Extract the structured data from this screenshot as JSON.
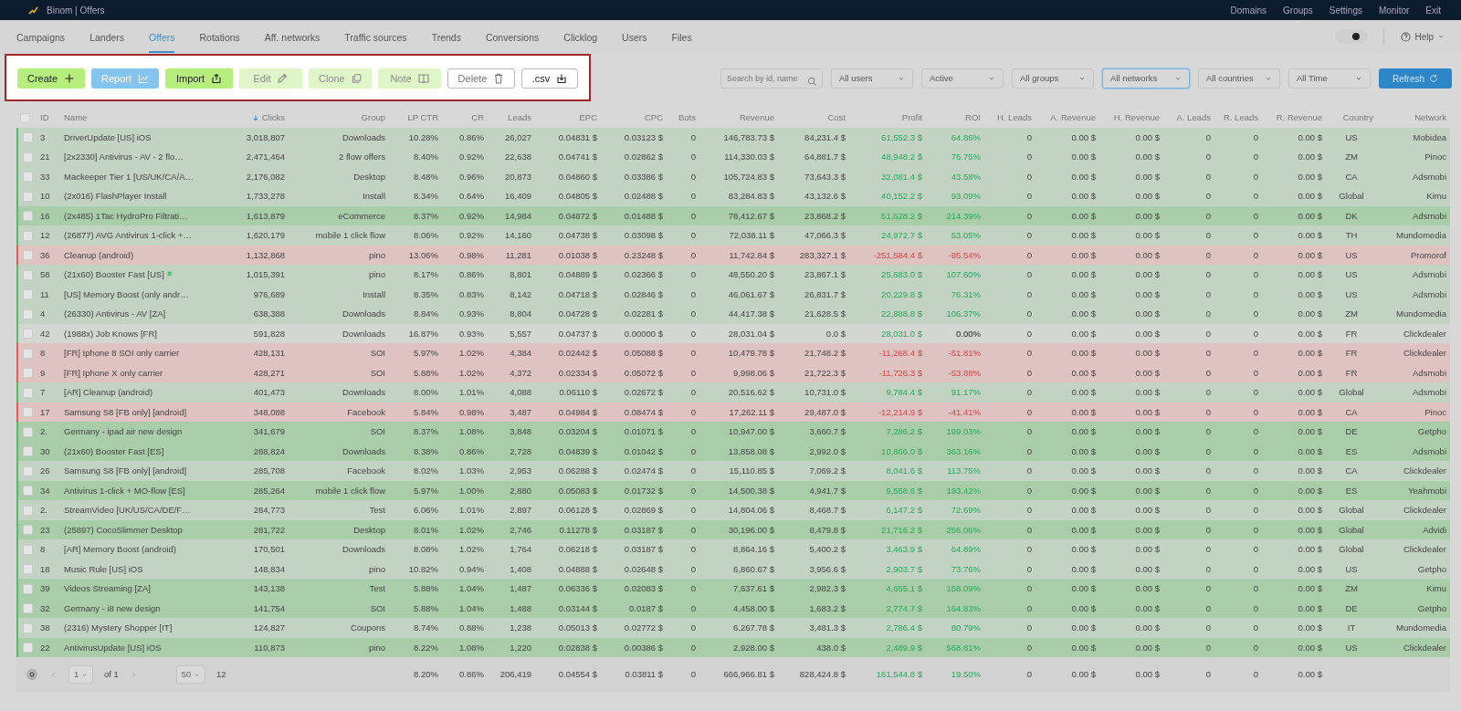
{
  "app_bar": {
    "title": "Binom | Offers",
    "links": [
      "Domains",
      "Groups",
      "Settings",
      "Monitor",
      "Exit"
    ]
  },
  "tabs": [
    {
      "label": "Campaigns",
      "selected": false
    },
    {
      "label": "Landers",
      "selected": false
    },
    {
      "label": "Offers",
      "selected": true
    },
    {
      "label": "Rotations",
      "selected": false
    },
    {
      "label": "Aff. networks",
      "selected": false
    },
    {
      "label": "Traffic sources",
      "selected": false
    },
    {
      "label": "Trends",
      "selected": false
    },
    {
      "label": "Conversions",
      "selected": false
    },
    {
      "label": "Clicklog",
      "selected": false
    },
    {
      "label": "Users",
      "selected": false
    },
    {
      "label": "Files",
      "selected": false
    }
  ],
  "theme_toggle": {
    "on": true
  },
  "help": {
    "label": "Help"
  },
  "toolbar": [
    {
      "label": "Create",
      "kind": "create"
    },
    {
      "label": "Report",
      "kind": "report"
    },
    {
      "label": "Import",
      "kind": "import"
    },
    {
      "label": "Edit",
      "kind": "edit"
    },
    {
      "label": "Clone",
      "kind": "clone"
    },
    {
      "label": "Note",
      "kind": "note"
    },
    {
      "label": "Delete",
      "kind": "delete"
    },
    {
      "label": ".csv",
      "kind": "export"
    }
  ],
  "search": {
    "placeholder": "Search by id, name"
  },
  "filters": [
    {
      "value": "All users",
      "focused": false
    },
    {
      "value": "Active",
      "focused": false
    },
    {
      "value": "All groups",
      "focused": false
    },
    {
      "value": "All networks",
      "focused": true
    },
    {
      "value": "All countries",
      "focused": false
    },
    {
      "value": "All Time",
      "focused": false
    }
  ],
  "refresh": {
    "label": "Refresh"
  },
  "table": {
    "select_all": {
      "checked": false
    },
    "columns": [
      {
        "label": "ID",
        "sorted": false
      },
      {
        "label": "Name",
        "sorted": false
      },
      {
        "label": "Clicks",
        "sorted": true
      },
      {
        "label": "Group",
        "sorted": false
      },
      {
        "label": "LP CTR",
        "sorted": false
      },
      {
        "label": "CR",
        "sorted": false
      },
      {
        "label": "Leads",
        "sorted": false
      },
      {
        "label": "EPC",
        "sorted": false
      },
      {
        "label": "CPC",
        "sorted": false
      },
      {
        "label": "Bots",
        "sorted": false
      },
      {
        "label": "Revenue",
        "sorted": false
      },
      {
        "label": "Cost",
        "sorted": false
      },
      {
        "label": "Profit",
        "sorted": false
      },
      {
        "label": "ROI",
        "sorted": false
      },
      {
        "label": "H. Leads",
        "sorted": false
      },
      {
        "label": "A. Revenue",
        "sorted": false
      },
      {
        "label": "H. Revenue",
        "sorted": false
      },
      {
        "label": "A. Leads",
        "sorted": false
      },
      {
        "label": "R. Leads",
        "sorted": false
      },
      {
        "label": "R. Revenue",
        "sorted": false
      },
      {
        "label": "Country",
        "sorted": false
      },
      {
        "label": "Network",
        "sorted": false
      }
    ],
    "rows": [
      {
        "kind": "profit",
        "checked": false,
        "flag": false,
        "cells": [
          "3",
          "DriverUpdate [US] iOS",
          "3,018,807",
          "Downloads",
          "10.28%",
          "0.86%",
          "26,027",
          "0.04831 $",
          "0.03123 $",
          "0",
          "146,783.73 $",
          "84,231.4 $",
          "61,552.3 $",
          "64.86%",
          "0",
          "0.00 $",
          "0.00 $",
          "0",
          "0",
          "0.00 $",
          "US",
          "Mobidea"
        ]
      },
      {
        "kind": "profit",
        "checked": false,
        "flag": false,
        "cells": [
          "21",
          "[2x2330] Antivirus - AV - 2 flo…",
          "2,471,464",
          "2 flow offers",
          "8.40%",
          "0.92%",
          "22,638",
          "0.04741 $",
          "0.02862 $",
          "0",
          "114,330.03 $",
          "64,881.7 $",
          "48,948.2 $",
          "76.75%",
          "0",
          "0.00 $",
          "0.00 $",
          "0",
          "0",
          "0.00 $",
          "ZM",
          "Pinoc"
        ]
      },
      {
        "kind": "profit",
        "checked": false,
        "flag": false,
        "cells": [
          "33",
          "Mackeeper Tier 1 [US/UK/CA/A…",
          "2,176,082",
          "Desktop",
          "8.48%",
          "0.96%",
          "20,873",
          "0.04860 $",
          "0.03386 $",
          "0",
          "105,724.83 $",
          "73,643.3 $",
          "32,081.4 $",
          "43.58%",
          "0",
          "0.00 $",
          "0.00 $",
          "0",
          "0",
          "0.00 $",
          "CA",
          "Adsmobi"
        ]
      },
      {
        "kind": "profit",
        "checked": false,
        "flag": false,
        "cells": [
          "10",
          "(2x016) FlashPlayer Install",
          "1,733,278",
          "Install",
          "8.34%",
          "0.64%",
          "16,409",
          "0.04805 $",
          "0.02488 $",
          "0",
          "83,284.83 $",
          "43,132.6 $",
          "40,152.2 $",
          "93.09%",
          "0",
          "0.00 $",
          "0.00 $",
          "0",
          "0",
          "0.00 $",
          "Global",
          "Kimu"
        ]
      },
      {
        "kind": "high",
        "checked": false,
        "flag": false,
        "cells": [
          "16",
          "(2x485) 1Tac HydroPro Filtrati…",
          "1,613,879",
          "eCommerce",
          "8.37%",
          "0.92%",
          "14,984",
          "0.04872 $",
          "0.01488 $",
          "0",
          "78,412.67 $",
          "23,868.2 $",
          "51,628.2 $",
          "214.39%",
          "0",
          "0.00 $",
          "0.00 $",
          "0",
          "0",
          "0.00 $",
          "DK",
          "Adsmobi"
        ]
      },
      {
        "kind": "profit",
        "checked": false,
        "flag": false,
        "cells": [
          "12",
          "(26877) AVG Antivirus 1-click +…",
          "1,620,179",
          "mobile 1 click flow",
          "8.06%",
          "0.92%",
          "14,160",
          "0.04738 $",
          "0.03098 $",
          "0",
          "72,038.11 $",
          "47,066.3 $",
          "24,972.7 $",
          "53.05%",
          "0",
          "0.00 $",
          "0.00 $",
          "0",
          "0",
          "0.00 $",
          "TH",
          "Mundomedia"
        ]
      },
      {
        "kind": "loss",
        "checked": false,
        "flag": false,
        "cells": [
          "36",
          "Cleanup (android)",
          "1,132,868",
          "pino",
          "13.06%",
          "0.98%",
          "11,281",
          "0.01038 $",
          "0.23248 $",
          "0",
          "11,742.84 $",
          "283,327.1 $",
          "-251,584.4 $",
          "-95.54%",
          "0",
          "0.00 $",
          "0.00 $",
          "0",
          "0",
          "0.00 $",
          "US",
          "Promorof"
        ]
      },
      {
        "kind": "profit",
        "checked": false,
        "flag": true,
        "cells": [
          "58",
          "(21x60) Booster Fast [US]",
          "1,015,391",
          "pino",
          "8.17%",
          "0.86%",
          "8,801",
          "0.04889 $",
          "0.02366 $",
          "0",
          "48,550.20 $",
          "23,867.1 $",
          "25,683.0 $",
          "107.60%",
          "0",
          "0.00 $",
          "0.00 $",
          "0",
          "0",
          "0.00 $",
          "US",
          "Adsmobi"
        ]
      },
      {
        "kind": "profit",
        "checked": false,
        "flag": false,
        "cells": [
          "11",
          "[US] Memory Boost (only andr…",
          "976,689",
          "Install",
          "8.35%",
          "0.83%",
          "8,142",
          "0.04718 $",
          "0.02846 $",
          "0",
          "46,061.67 $",
          "26,831.7 $",
          "20,229.8 $",
          "76.31%",
          "0",
          "0.00 $",
          "0.00 $",
          "0",
          "0",
          "0.00 $",
          "US",
          "Adsmobi"
        ]
      },
      {
        "kind": "profit",
        "checked": false,
        "flag": false,
        "cells": [
          "4",
          "(26330) Antivirus - AV [ZA]",
          "638,388",
          "Downloads",
          "8.84%",
          "0.93%",
          "8,804",
          "0.04728 $",
          "0.02281 $",
          "0",
          "44,417.38 $",
          "21,628.5 $",
          "22,888.8 $",
          "106.37%",
          "0",
          "0.00 $",
          "0.00 $",
          "0",
          "0",
          "0.00 $",
          "ZM",
          "Mundomedia"
        ]
      },
      {
        "kind": "flat",
        "checked": false,
        "flag": false,
        "cells": [
          "42",
          "(1988x) Job Knows [FR]",
          "591,828",
          "Downloads",
          "16.87%",
          "0.93%",
          "5,557",
          "0.04737 $",
          "0.00000 $",
          "0",
          "28,031.04 $",
          "0.0 $",
          "28,031.0 $",
          "0.00%",
          "0",
          "0.00 $",
          "0.00 $",
          "0",
          "0",
          "0.00 $",
          "FR",
          "Clickdealer"
        ]
      },
      {
        "kind": "loss",
        "checked": false,
        "flag": false,
        "cells": [
          "8",
          "[FR] Iphone 8 SOI only carrier",
          "428,131",
          "SOI",
          "5.97%",
          "1.02%",
          "4,384",
          "0.02442 $",
          "0.05088 $",
          "0",
          "10,479.78 $",
          "21,748.2 $",
          "-11,268.4 $",
          "-51.81%",
          "0",
          "0.00 $",
          "0.00 $",
          "0",
          "0",
          "0.00 $",
          "FR",
          "Clickdealer"
        ]
      },
      {
        "kind": "loss",
        "checked": false,
        "flag": false,
        "cells": [
          "9",
          "[FR] Iphone X only carrier",
          "428,271",
          "SOI",
          "5.88%",
          "1.02%",
          "4,372",
          "0.02334 $",
          "0.05072 $",
          "0",
          "9,998.06 $",
          "21,722.3 $",
          "-11,726.3 $",
          "-53.88%",
          "0",
          "0.00 $",
          "0.00 $",
          "0",
          "0",
          "0.00 $",
          "FR",
          "Adsmobi"
        ]
      },
      {
        "kind": "profit",
        "checked": false,
        "flag": false,
        "cells": [
          "7",
          "[AR] Cleanup (android)",
          "401,473",
          "Downloads",
          "8.00%",
          "1.01%",
          "4,088",
          "0.06110 $",
          "0.02672 $",
          "0",
          "20,516.62 $",
          "10,731.0 $",
          "9,784.4 $",
          "91.17%",
          "0",
          "0.00 $",
          "0.00 $",
          "0",
          "0",
          "0.00 $",
          "Global",
          "Adsmobi"
        ]
      },
      {
        "kind": "loss",
        "checked": false,
        "flag": false,
        "cells": [
          "17",
          "Samsung S8 [FB only] [android]",
          "348,088",
          "Facebook",
          "5.84%",
          "0.98%",
          "3,487",
          "0.04984 $",
          "0.08474 $",
          "0",
          "17,262.11 $",
          "29,487.0 $",
          "-12,214.9 $",
          "-41.41%",
          "0",
          "0.00 $",
          "0.00 $",
          "0",
          "0",
          "0.00 $",
          "CA",
          "Pinoc"
        ]
      },
      {
        "kind": "high",
        "checked": false,
        "flag": false,
        "cells": [
          "2.",
          "Germany - ipad air new design",
          "341,679",
          "SOI",
          "8.37%",
          "1.08%",
          "3,848",
          "0.03204 $",
          "0.01071 $",
          "0",
          "10,947.00 $",
          "3,660.7 $",
          "7,286.2 $",
          "199.03%",
          "0",
          "0.00 $",
          "0.00 $",
          "0",
          "0",
          "0.00 $",
          "DE",
          "Getpho"
        ]
      },
      {
        "kind": "high",
        "checked": false,
        "flag": false,
        "cells": [
          "30",
          "(21x60) Booster Fast [ES]",
          "288,824",
          "Downloads",
          "8.38%",
          "0.86%",
          "2,728",
          "0.04839 $",
          "0.01042 $",
          "0",
          "13,858.08 $",
          "2,992.0 $",
          "10,866.0 $",
          "363.16%",
          "0",
          "0.00 $",
          "0.00 $",
          "0",
          "0",
          "0.00 $",
          "ES",
          "Adsmobi"
        ]
      },
      {
        "kind": "profit",
        "checked": false,
        "flag": false,
        "cells": [
          "26",
          "Samsung S8 [FB only] [android]",
          "285,708",
          "Facebook",
          "8.02%",
          "1.03%",
          "2,953",
          "0.06288 $",
          "0.02474 $",
          "0",
          "15,110.85 $",
          "7,069.2 $",
          "8,041.6 $",
          "113.75%",
          "0",
          "0.00 $",
          "0.00 $",
          "0",
          "0",
          "0.00 $",
          "CA",
          "Clickdealer"
        ]
      },
      {
        "kind": "high",
        "checked": false,
        "flag": false,
        "cells": [
          "34",
          "Antivirus 1-click + MO-flow [ES]",
          "285,264",
          "mobile 1 click flow",
          "5.97%",
          "1.00%",
          "2,880",
          "0.05083 $",
          "0.01732 $",
          "0",
          "14,500.38 $",
          "4,941.7 $",
          "9,558.6 $",
          "193.42%",
          "0",
          "0.00 $",
          "0.00 $",
          "0",
          "0",
          "0.00 $",
          "ES",
          "Yeahmobi"
        ]
      },
      {
        "kind": "profit",
        "checked": false,
        "flag": false,
        "cells": [
          "2.",
          "StreamVideo [UK/US/CA/DE/F…",
          "284,773",
          "Test",
          "6.06%",
          "1.01%",
          "2,897",
          "0.06128 $",
          "0.02869 $",
          "0",
          "14,804.06 $",
          "8,468.7 $",
          "6,147.2 $",
          "72.69%",
          "0",
          "0.00 $",
          "0.00 $",
          "0",
          "0",
          "0.00 $",
          "Global",
          "Clickdealer"
        ]
      },
      {
        "kind": "high",
        "checked": false,
        "flag": false,
        "cells": [
          "23",
          "(25897) CocoSlimmer Desktop",
          "281,722",
          "Desktop",
          "8.01%",
          "1.02%",
          "2,746",
          "0.11278 $",
          "0.03187 $",
          "0",
          "30,196.00 $",
          "8,479.8 $",
          "21,716.2 $",
          "256.06%",
          "0",
          "0.00 $",
          "0.00 $",
          "0",
          "0",
          "0.00 $",
          "Global",
          "Advidi"
        ]
      },
      {
        "kind": "profit",
        "checked": false,
        "flag": false,
        "cells": [
          "8",
          "[AR] Memory Boost (android)",
          "170,501",
          "Downloads",
          "8.08%",
          "1.02%",
          "1,764",
          "0.06218 $",
          "0.03187 $",
          "0",
          "8,864.16 $",
          "5,400.2 $",
          "3,463.9 $",
          "64.89%",
          "0",
          "0.00 $",
          "0.00 $",
          "0",
          "0",
          "0.00 $",
          "Global",
          "Clickdealer"
        ]
      },
      {
        "kind": "profit",
        "checked": false,
        "flag": false,
        "cells": [
          "18",
          "Music Rule [US] iOS",
          "148,834",
          "pino",
          "10.82%",
          "0.94%",
          "1,408",
          "0.04888 $",
          "0.02648 $",
          "0",
          "6,860.67 $",
          "3,956.6 $",
          "2,903.7 $",
          "73.76%",
          "0",
          "0.00 $",
          "0.00 $",
          "0",
          "0",
          "0.00 $",
          "US",
          "Getpho"
        ]
      },
      {
        "kind": "high",
        "checked": false,
        "flag": false,
        "cells": [
          "39",
          "Videos Streaming [ZA]",
          "143,138",
          "Test",
          "5.88%",
          "1.04%",
          "1,487",
          "0.06336 $",
          "0.02083 $",
          "0",
          "7,637.61 $",
          "2,982.3 $",
          "4,655.1 $",
          "158.09%",
          "0",
          "0.00 $",
          "0.00 $",
          "0",
          "0",
          "0.00 $",
          "ZM",
          "Kimu"
        ]
      },
      {
        "kind": "high",
        "checked": false,
        "flag": false,
        "cells": [
          "32",
          "Germany - i8 new design",
          "141,754",
          "SOI",
          "5.88%",
          "1.04%",
          "1,488",
          "0.03144 $",
          "0.0187 $",
          "0",
          "4,458.00 $",
          "1,683.2 $",
          "2,774.7 $",
          "164.83%",
          "0",
          "0.00 $",
          "0.00 $",
          "0",
          "0",
          "0.00 $",
          "DE",
          "Getpho"
        ]
      },
      {
        "kind": "profit",
        "checked": false,
        "flag": false,
        "cells": [
          "38",
          "(2316) Mystery Shopper [IT]",
          "124,827",
          "Coupons",
          "8.74%",
          "0.88%",
          "1,238",
          "0.05013 $",
          "0.02772 $",
          "0",
          "6,267.78 $",
          "3,481.3 $",
          "2,786.4 $",
          "80.79%",
          "0",
          "0.00 $",
          "0.00 $",
          "0",
          "0",
          "0.00 $",
          "IT",
          "Mundomedia"
        ]
      },
      {
        "kind": "high",
        "checked": false,
        "flag": false,
        "cells": [
          "22",
          "AntivirusUpdate [US] iOS",
          "110,873",
          "pino",
          "8.22%",
          "1.08%",
          "1,220",
          "0.02838 $",
          "0.00386 $",
          "0",
          "2,928.00 $",
          "438.0 $",
          "2,489.9 $",
          "568.81%",
          "0",
          "0.00 $",
          "0.00 $",
          "0",
          "0",
          "0.00 $",
          "US",
          "Clickdealer"
        ]
      }
    ]
  },
  "footer": {
    "page": "1",
    "of": "of 1",
    "per_page": "50",
    "count": "12",
    "totals": [
      "8.20%",
      "0.86%",
      "206,419",
      "0.04554 $",
      "0.03811 $",
      "0",
      "666,966.81 $",
      "828,424.8 $",
      "161,544.8 $",
      "19.50%",
      "0",
      "0.00 $",
      "0.00 $",
      "0",
      "0",
      "0.00 $"
    ]
  }
}
